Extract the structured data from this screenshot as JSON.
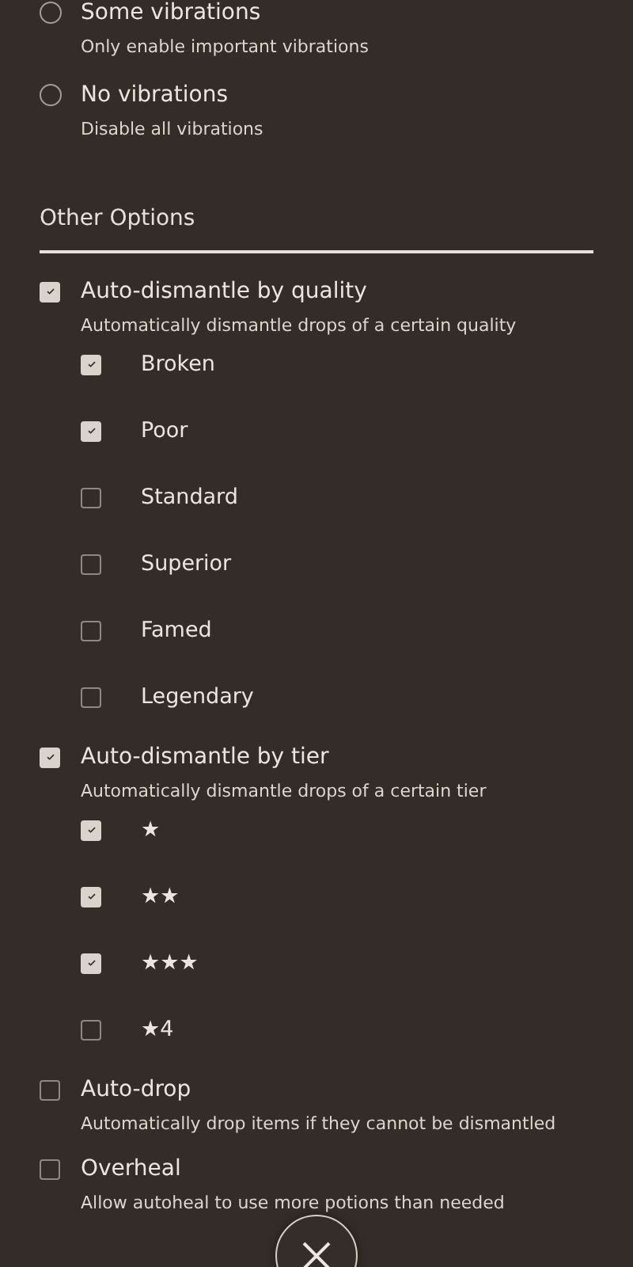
{
  "vibration_options": [
    {
      "label": "Some vibrations",
      "description": "Only enable important vibrations",
      "selected": false
    },
    {
      "label": "No vibrations",
      "description": "Disable all vibrations",
      "selected": false
    }
  ],
  "other_options": {
    "title": "Other Options",
    "items": [
      {
        "label": "Auto-dismantle by quality",
        "description": "Automatically dismantle drops of a certain quality",
        "checked": true,
        "children": [
          {
            "label": "Broken",
            "checked": true
          },
          {
            "label": "Poor",
            "checked": true
          },
          {
            "label": "Standard",
            "checked": false
          },
          {
            "label": "Superior",
            "checked": false
          },
          {
            "label": "Famed",
            "checked": false
          },
          {
            "label": "Legendary",
            "checked": false
          }
        ]
      },
      {
        "label": "Auto-dismantle by tier",
        "description": "Automatically dismantle drops of a certain tier",
        "checked": true,
        "children": [
          {
            "label": "★",
            "checked": true
          },
          {
            "label": "★★",
            "checked": true
          },
          {
            "label": "★★★",
            "checked": true
          },
          {
            "label": "★4",
            "checked": false
          }
        ]
      },
      {
        "label": "Auto-drop",
        "description": "Automatically drop items if they cannot be dismantled",
        "checked": false
      },
      {
        "label": "Overheal",
        "description": "Allow autoheal to use more potions than needed",
        "checked": false
      }
    ]
  }
}
